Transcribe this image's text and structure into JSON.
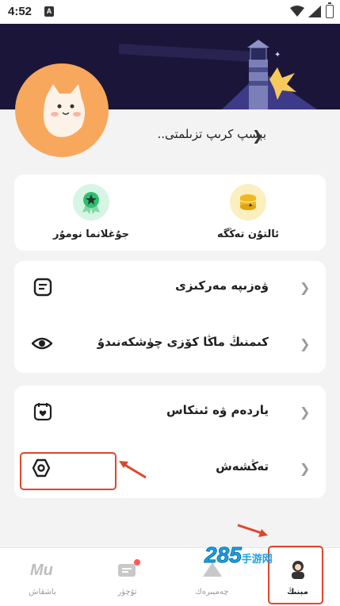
{
  "status_bar": {
    "time": "4:52",
    "notification_letter": "A"
  },
  "profile": {
    "username_prompt": "بېسپ كرىپ تزىلمتى.."
  },
  "quick_actions": [
    {
      "label": "ئالتۇن تەڭگە",
      "icon": "gold-coin-icon"
    },
    {
      "label": "جۇغلانما نومۇر",
      "icon": "award-medal-icon"
    }
  ],
  "menu_group_1": [
    {
      "label": "ۋەزىپە مەركىزى",
      "icon": "task-list-icon"
    },
    {
      "label": "كىمنىڭ ماڭا كۆزى چۈشكەنىدۇ",
      "icon": "eye-icon"
    }
  ],
  "menu_group_2": [
    {
      "label": "ياردەم ۋە ئىنكاس",
      "icon": "help-feedback-icon"
    },
    {
      "label": "تەڭشەش",
      "icon": "settings-gear-icon"
    }
  ],
  "tabs": [
    {
      "label": "باشقاش",
      "icon": "mu-logo-icon"
    },
    {
      "label": "تۆچۈر",
      "icon": "chat-bubble-icon"
    },
    {
      "label": "چەمبىرەك",
      "icon": "discover-icon"
    },
    {
      "label": "مېنىڭ",
      "icon": "me-avatar-icon",
      "active": true
    }
  ],
  "watermark": {
    "text": "285",
    "suffix": "手游网"
  },
  "colors": {
    "accent_red": "#e0452b",
    "banner": "#1b1639",
    "avatar_bg": "#f7a85d",
    "badge_red": "#ff5a5a"
  }
}
